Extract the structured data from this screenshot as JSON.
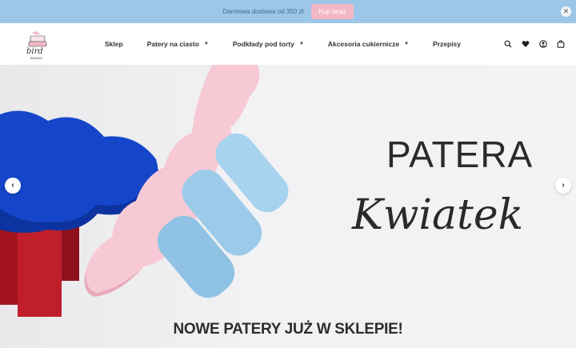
{
  "announcement": {
    "text": "Darmowa dostawa od 350 zł.",
    "button_label": "Kup teraz",
    "close_glyph": "✕"
  },
  "header": {
    "logo_text_1": "bird",
    "logo_text_2": "BAKING",
    "nav": [
      {
        "label": "Sklep",
        "has_dropdown": false
      },
      {
        "label": "Patery na ciasto",
        "has_dropdown": true
      },
      {
        "label": "Podkłady pod torty",
        "has_dropdown": true
      },
      {
        "label": "Akcesoria cukiernicze",
        "has_dropdown": true
      },
      {
        "label": "Przepisy",
        "has_dropdown": false
      }
    ],
    "icons": [
      "search-icon",
      "heart-icon",
      "account-icon",
      "bag-icon"
    ]
  },
  "hero": {
    "title": "PATERA",
    "script_title": "Kwiatek",
    "caption": "NOWE PATERY JUŻ W SKLEPIE!",
    "prev_glyph": "‹",
    "next_glyph": "›"
  },
  "colors": {
    "announce_bg": "#9dc7e8",
    "button_pink": "#f2b8c6",
    "blue_flower": "#1546c9",
    "pink_flower": "#f6c9d4",
    "light_blue_legs": "#9ccbea",
    "red_legs": "#b3182a"
  }
}
